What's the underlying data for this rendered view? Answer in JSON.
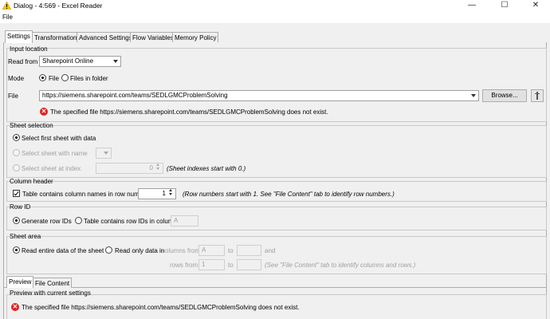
{
  "window": {
    "title": "Dialog - 4:569 - Excel Reader",
    "warning_icon": "warning-triangle-icon",
    "controls": {
      "minimize": "—",
      "maximize": "☐",
      "close": "✕"
    }
  },
  "menu": {
    "file": "File"
  },
  "tabs": [
    {
      "label": "Settings",
      "active": true
    },
    {
      "label": "Transformation"
    },
    {
      "label": "Advanced Settings"
    },
    {
      "label": "Flow Variables"
    },
    {
      "label": "Memory Policy"
    }
  ],
  "input_location": {
    "title": "Input location",
    "read_from_label": "Read from",
    "read_from_value": "Sharepoint Online",
    "mode_label": "Mode",
    "mode_file": "File",
    "mode_folder": "Files in folder",
    "file_label": "File",
    "file_value": "https://siemens.sharepoint.com/teams/SEDLGMCProblemSolving",
    "browse_label": "Browse...",
    "error_text": "The specified file https://siemens.sharepoint.com/teams/SEDLGMCProblemSolving does not exist."
  },
  "sheet_selection": {
    "title": "Sheet selection",
    "first_sheet": "Select first sheet with data",
    "sheet_with_name": "Select sheet with name",
    "sheet_at_index": "Select sheet at index",
    "index_value": "0",
    "index_hint": "(Sheet indexes start with 0.)"
  },
  "column_header": {
    "title": "Column header",
    "checkbox_label": "Table contains column names in row number",
    "row_number": "1",
    "hint": "(Row numbers start with 1. See \"File Content\" tab to identify row numbers.)"
  },
  "row_id": {
    "title": "Row ID",
    "generate": "Generate row IDs",
    "contains": "Table contains row IDs in column",
    "column_value": "A"
  },
  "sheet_area": {
    "title": "Sheet area",
    "entire": "Read entire data of the sheet",
    "only": "Read only data in",
    "columns_from": "columns from",
    "col_from_value": "A",
    "to": "to",
    "and": "and",
    "rows_from": "rows from",
    "row_from_value": "1",
    "hint": "(See \"File Content\" tab to identify columns and rows.)"
  },
  "bottom_tabs": [
    {
      "label": "Preview",
      "active": true
    },
    {
      "label": "File Content"
    }
  ],
  "preview": {
    "title": "Preview with current settings",
    "error_text": "The specified file https://siemens.sharepoint.com/teams/SEDLGMCProblemSolving does not exist."
  }
}
